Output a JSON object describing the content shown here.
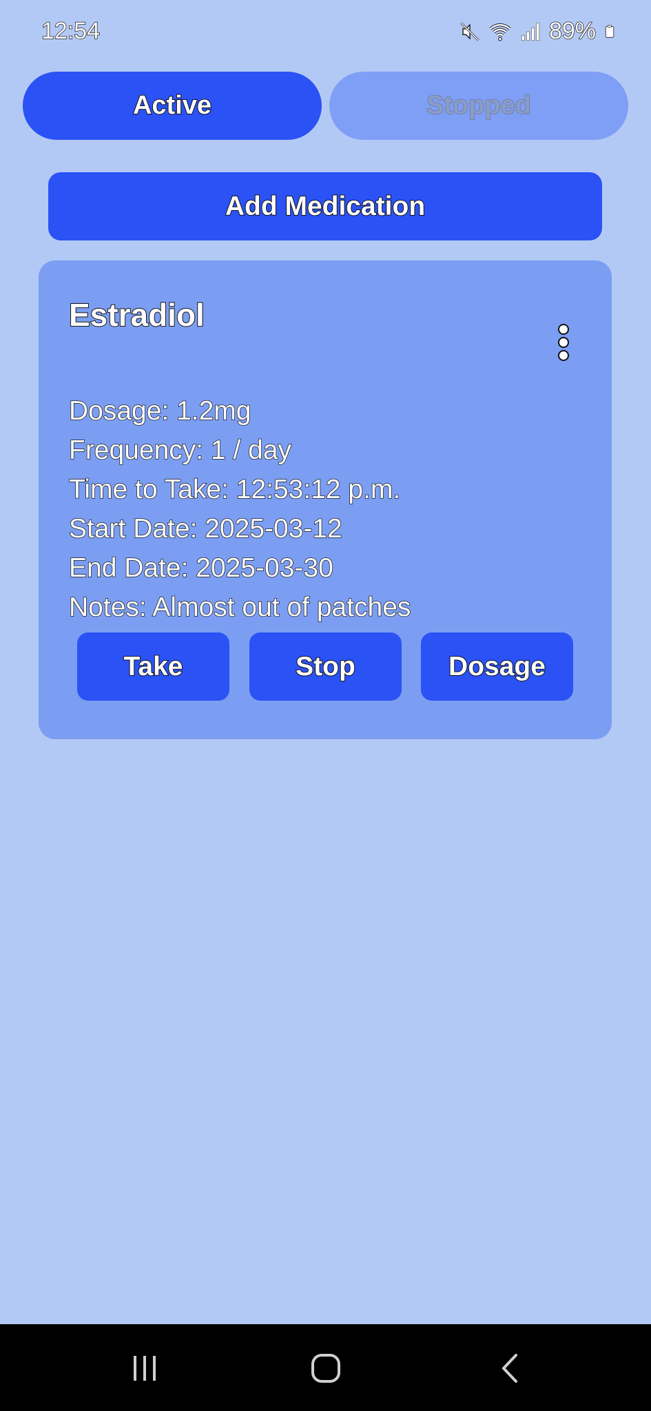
{
  "status_bar": {
    "time": "12:54",
    "battery": "89%",
    "icons": [
      "mute-icon",
      "wifi-icon",
      "signal-icon",
      "battery-icon"
    ]
  },
  "tabs": [
    {
      "label": "Active",
      "selected": true
    },
    {
      "label": "Stopped",
      "selected": false
    }
  ],
  "add_button": {
    "label": "Add Medication"
  },
  "medications": [
    {
      "name": "Estradiol",
      "dosage": "Dosage: 1.2mg",
      "frequency": "Frequency: 1 / day",
      "time_to_take": "Time to Take: 12:53:12 p.m.",
      "start_date": "Start Date: 2025-03-12",
      "end_date": "End Date: 2025-03-30",
      "notes": "Notes: Almost out of patches",
      "actions": {
        "take": "Take",
        "stop": "Stop",
        "dosage": "Dosage"
      }
    }
  ],
  "colors": {
    "background": "#b3c9f5",
    "primary": "#2a52f5",
    "card": "#7b9ef3",
    "tab_inactive": "#7f9ef6",
    "nav_bar": "#000000"
  },
  "nav_bar": {
    "icons": [
      "recent-apps-icon",
      "home-icon",
      "back-icon"
    ]
  }
}
